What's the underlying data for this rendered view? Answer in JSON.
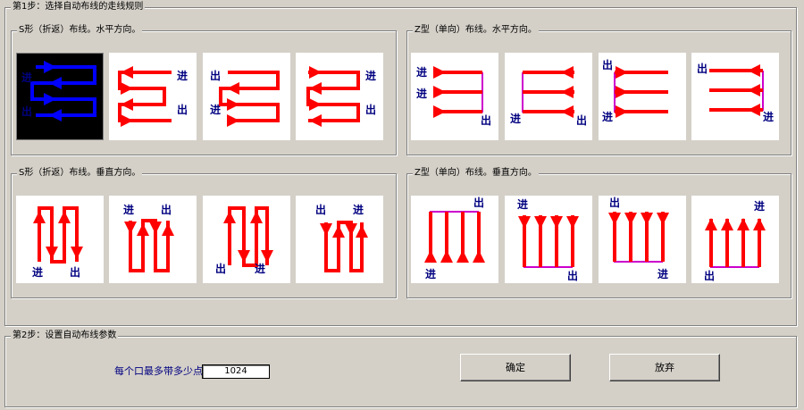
{
  "step1": {
    "title": "第1步：选择自动布线的走线规则",
    "groups": [
      {
        "title": "S形（折返）布线。水平方向。"
      },
      {
        "title": "Z型（单向）布线。水平方向。"
      },
      {
        "title": "S形（折返）布线。垂直方向。"
      },
      {
        "title": "Z型（单向）布线。垂直方向。"
      }
    ],
    "selected_index": 0
  },
  "labels": {
    "in": "进",
    "out": "出"
  },
  "step2": {
    "title": "第2步：设置自动布线参数",
    "points_label": "每个口最多带多少点：",
    "points_value": "1024"
  },
  "buttons": {
    "ok": "确定",
    "cancel": "放弃"
  },
  "colors": {
    "arrow_red": "#ff0000",
    "arrow_blue": "#0000ff",
    "return_line": "#cc00cc",
    "label_blue": "#000080"
  }
}
